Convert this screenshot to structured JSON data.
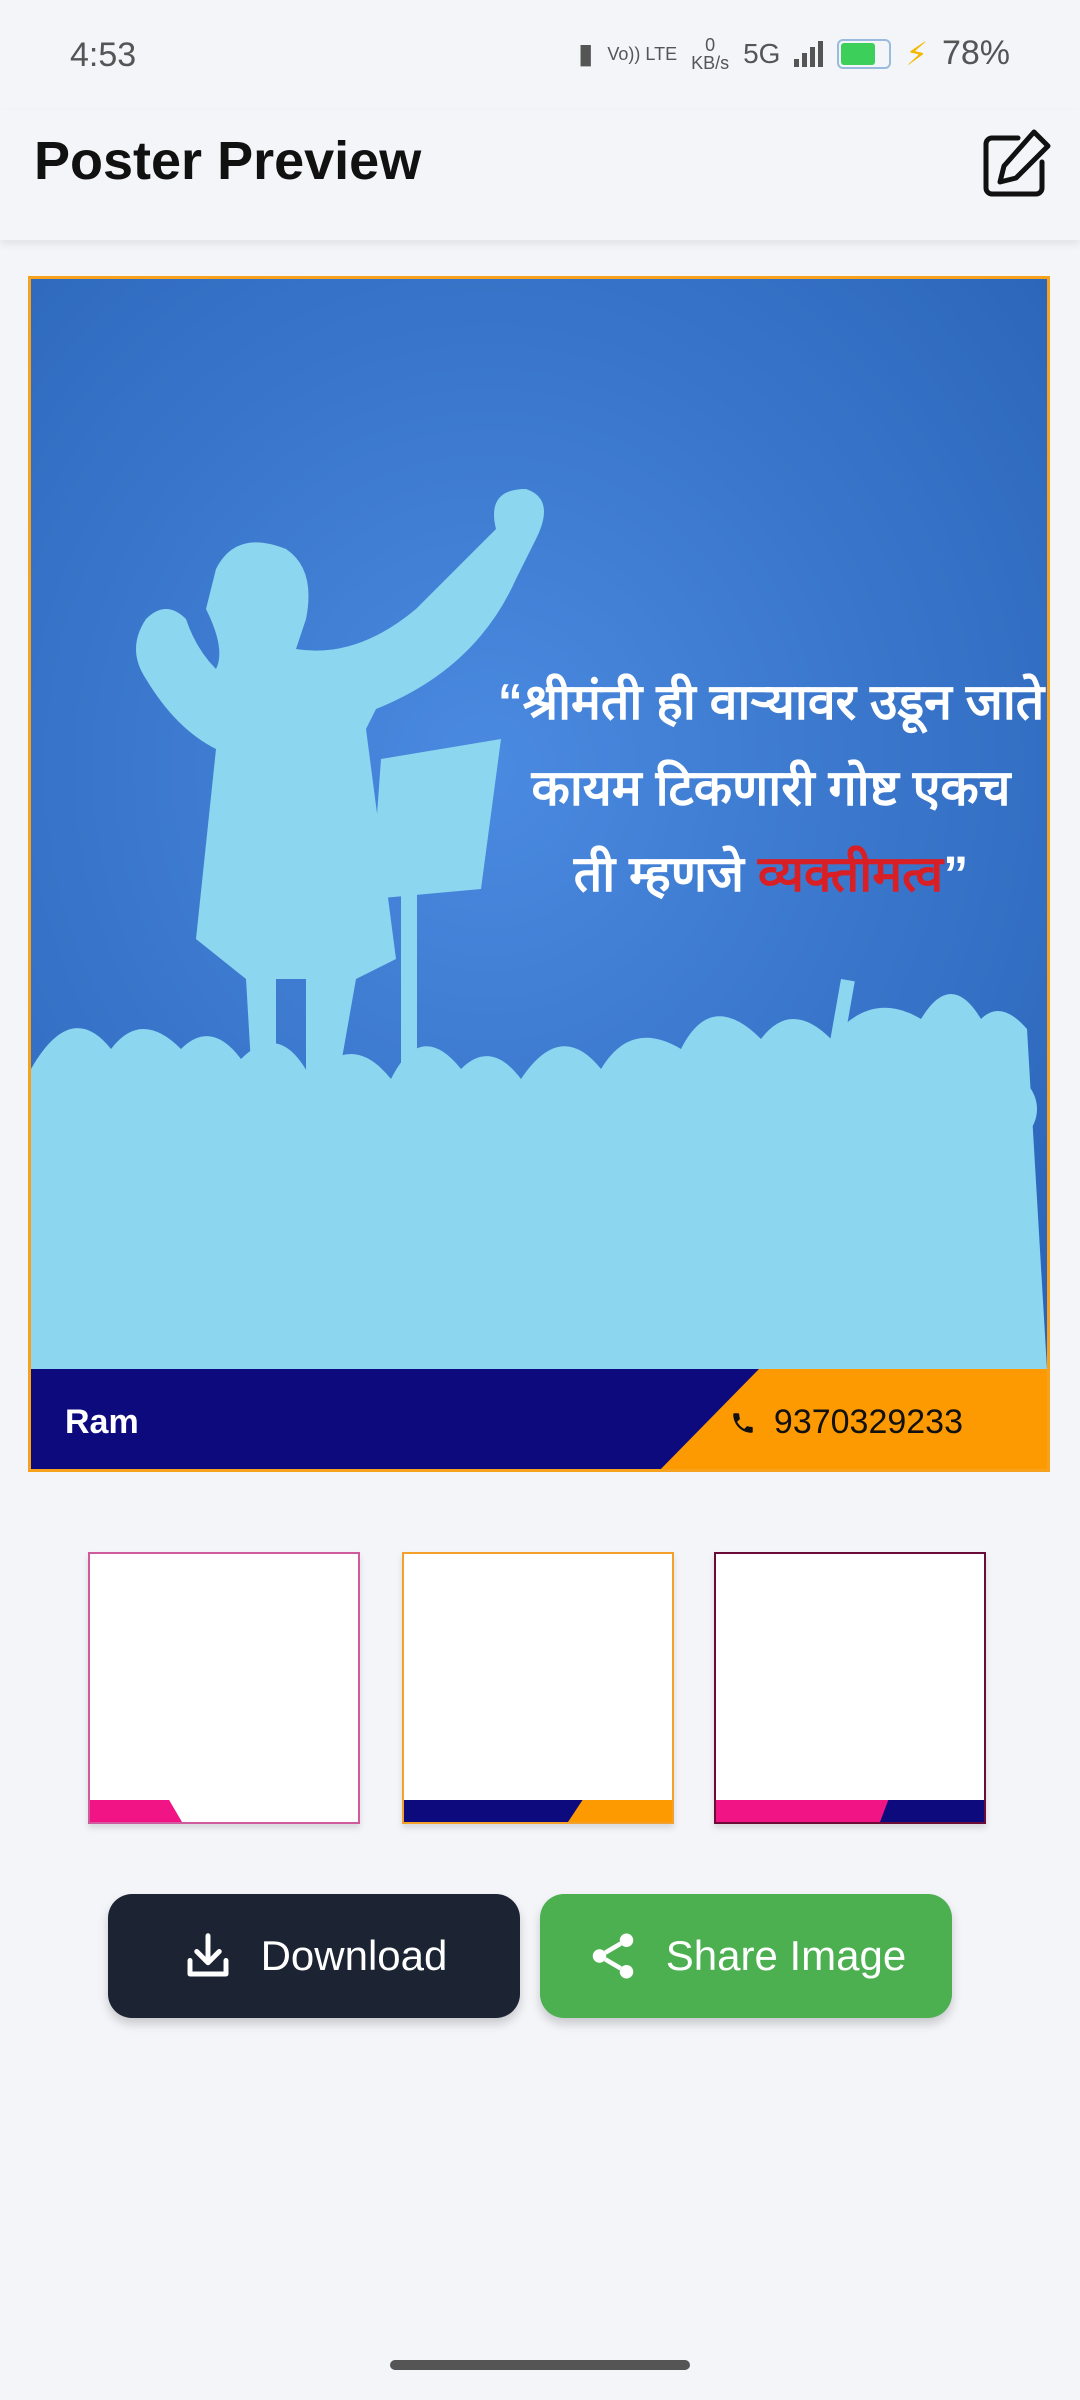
{
  "status": {
    "time": "4:53",
    "data_speed_value": "0",
    "data_speed_unit": "KB/s",
    "network": "5G",
    "volte": "Vo)) LTE",
    "battery_percent": "78%",
    "battery_level": 0.78
  },
  "header": {
    "title": "Poster Preview",
    "edit_icon": "edit-icon"
  },
  "poster": {
    "quote_line1": "“श्रीमंती ही वाऱ्यावर उडून जाते",
    "quote_line2": "कायम टिकणारी गोष्ट एकच",
    "quote_line3_start": "ती म्हणजे ",
    "quote_highlight": "व्यक्तीमत्व",
    "quote_line3_end": "”",
    "name": "Ram",
    "phone": "9370329233",
    "colors": {
      "sky": "#3f7fd8",
      "silhouette": "#8cd6f0",
      "footer_dark": "#0d0a7e",
      "footer_accent": "#fe9a01",
      "highlight": "#d81f26",
      "frame_border": "#f6a21d"
    }
  },
  "templates": [
    {
      "id": "template-1",
      "border": "#d05a9e",
      "band_colors": [
        "#f01485"
      ]
    },
    {
      "id": "template-2",
      "border": "#f3a12a",
      "band_colors": [
        "#0d0a7e",
        "#fe9a01"
      ]
    },
    {
      "id": "template-3",
      "border": "#6a0b38",
      "band_colors": [
        "#f01485",
        "#0d0a7e"
      ]
    }
  ],
  "actions": {
    "download_label": "Download",
    "share_label": "Share Image",
    "download_icon": "download-icon",
    "share_icon": "share-icon"
  }
}
